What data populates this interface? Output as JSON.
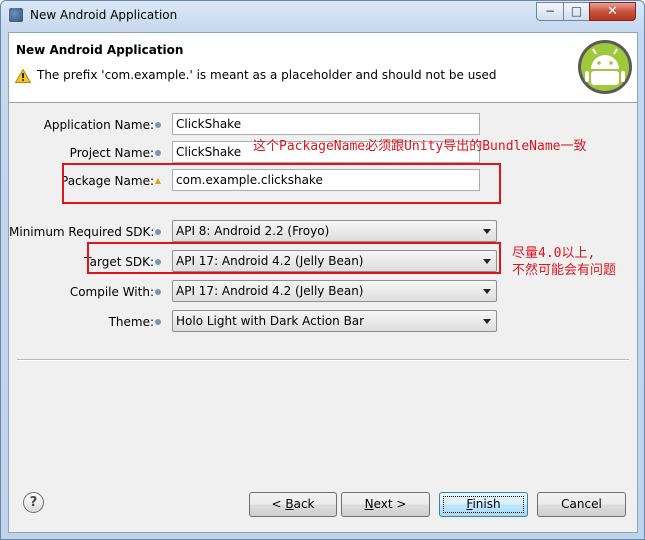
{
  "window": {
    "title": "New Android Application",
    "min_glyph": "−",
    "max_glyph": "□",
    "close_glyph": "✕"
  },
  "header": {
    "title": "New Android Application",
    "message": "The prefix 'com.example.' is meant as a placeholder and should not be used"
  },
  "form": {
    "application_name": {
      "label": "Application Name:",
      "value": "ClickShake"
    },
    "project_name": {
      "label": "Project Name:",
      "value": "ClickShake"
    },
    "package_name": {
      "label": "Package Name:",
      "value": "com.example.clickshake"
    },
    "min_sdk": {
      "label": "Minimum Required SDK:",
      "value": "API 8: Android 2.2 (Froyo)"
    },
    "target_sdk": {
      "label": "Target SDK:",
      "value": "API 17: Android 4.2 (Jelly Bean)"
    },
    "compile_with": {
      "label": "Compile With:",
      "value": "API 17: Android 4.2 (Jelly Bean)"
    },
    "theme": {
      "label": "Theme:",
      "value": "Holo Light with Dark Action Bar"
    }
  },
  "annotations": {
    "package_note": "这个PackageName必须跟Unity导出的BundleName一致",
    "sdk_note_line1": "尽量4.0以上,",
    "sdk_note_line2": "不然可能会有问题"
  },
  "buttons": {
    "help": "?",
    "back_prefix": "< ",
    "back_mnemonic": "B",
    "back_rest": "ack",
    "next_mnemonic": "N",
    "next_rest": "ext >",
    "finish_mnemonic": "F",
    "finish_rest": "inish",
    "cancel": "Cancel"
  },
  "colors": {
    "annotation_red": "#e0151b",
    "android_green": "#9fc83a"
  },
  "icons": {
    "warning": "warning-icon",
    "info": "info-icon",
    "help": "help-icon",
    "logo": "android-logo-icon"
  }
}
